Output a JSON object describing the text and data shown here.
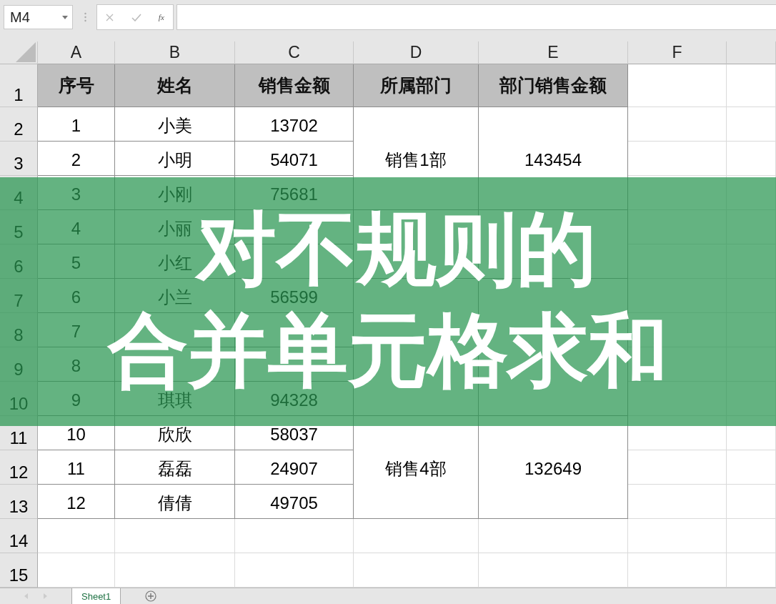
{
  "name_box": {
    "value": "M4"
  },
  "formula_bar": {
    "function_label": "fx"
  },
  "columns": [
    "A",
    "B",
    "C",
    "D",
    "E",
    "F"
  ],
  "row_numbers": [
    "1",
    "2",
    "3",
    "4",
    "5",
    "6",
    "7",
    "8",
    "9",
    "10",
    "11",
    "12",
    "13",
    "14",
    "15"
  ],
  "table": {
    "header": [
      "序号",
      "姓名",
      "销售金额",
      "所属部门",
      "部门销售金额"
    ],
    "departments": [
      {
        "name": "销售1部",
        "total": "143454",
        "people": [
          {
            "no": "1",
            "name": "小美",
            "amount": "13702"
          },
          {
            "no": "2",
            "name": "小明",
            "amount": "54071"
          },
          {
            "no": "3",
            "name": "小刚",
            "amount": "75681"
          }
        ]
      },
      {
        "people": [
          {
            "no": "4",
            "name": "小丽"
          },
          {
            "no": "5",
            "name": "小红"
          }
        ]
      },
      {
        "people": [
          {
            "no": "6",
            "name": "小兰",
            "amount": "56599"
          },
          {
            "no": "7"
          },
          {
            "no": "8"
          },
          {
            "no": "9",
            "name": "琪琪",
            "amount": "94328"
          }
        ]
      },
      {
        "name": "销售4部",
        "total": "132649",
        "people": [
          {
            "no": "10",
            "name": "欣欣",
            "amount": "58037"
          },
          {
            "no": "11",
            "name": "磊磊",
            "amount": "24907"
          },
          {
            "no": "12",
            "name": "倩倩",
            "amount": "49705"
          }
        ]
      }
    ]
  },
  "banner": {
    "lines": [
      "对不规则的",
      "合并单元格求和"
    ]
  },
  "sheet_tabs": [
    {
      "label": "Sheet1",
      "selected": true
    }
  ]
}
